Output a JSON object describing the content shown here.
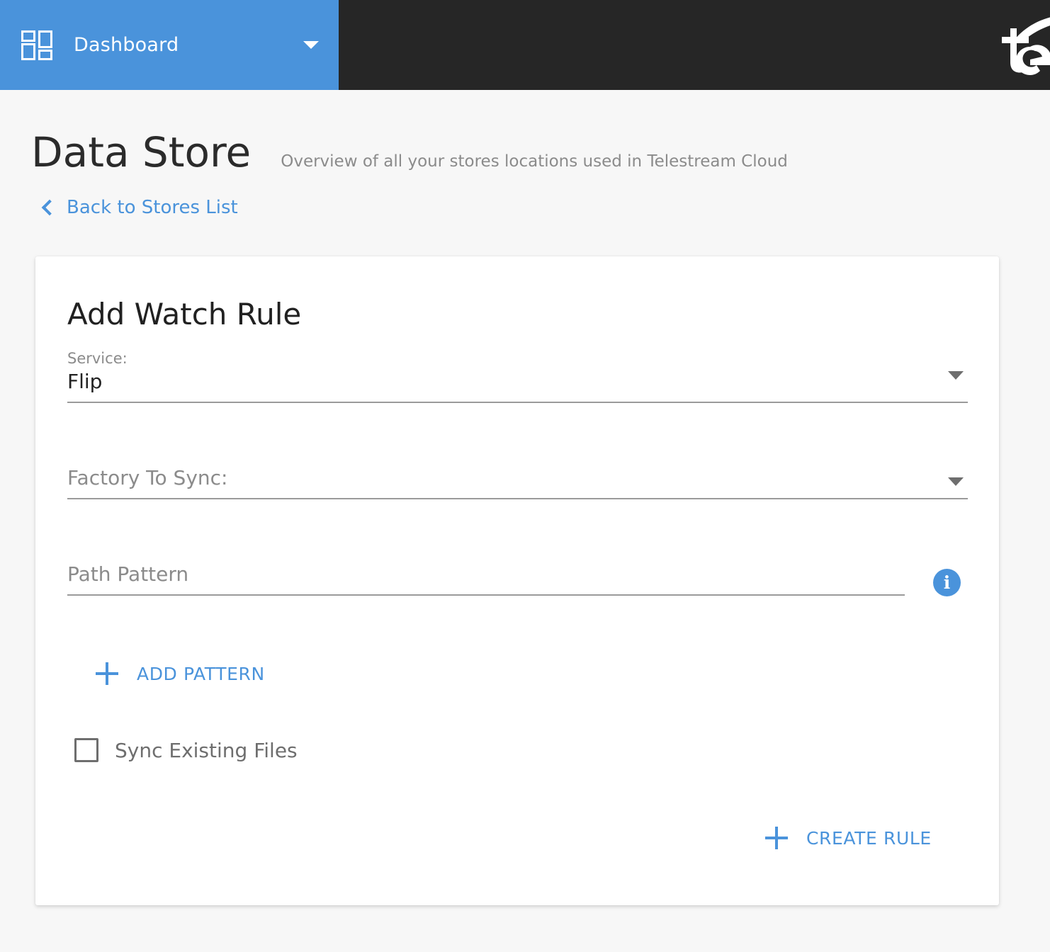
{
  "topbar": {
    "nav_label": "Dashboard",
    "nav_icon": "dashboard-grid-icon",
    "caret_icon": "caret-down-icon",
    "brand_logo_text": "te",
    "blue": "#4a93db",
    "dark": "#262626"
  },
  "page": {
    "title": "Data Store",
    "subtitle": "Overview of all your stores locations used in Telestream Cloud",
    "back_link": "Back to Stores List",
    "back_icon": "chevron-left-icon"
  },
  "card": {
    "title": "Add Watch Rule",
    "service": {
      "label": "Service:",
      "value": "Flip",
      "caret_icon": "caret-down-icon"
    },
    "factory": {
      "placeholder": "Factory To Sync:",
      "value": "",
      "caret_icon": "caret-down-icon"
    },
    "path_pattern": {
      "placeholder": "Path Pattern",
      "value": "",
      "info_icon": "info-icon",
      "info_glyph": "i"
    },
    "add_pattern": {
      "label": "ADD PATTERN",
      "icon": "plus-icon"
    },
    "sync_existing": {
      "label": "Sync Existing Files",
      "checked": false
    },
    "create_rule": {
      "label": "CREATE RULE",
      "icon": "plus-icon"
    }
  },
  "colors": {
    "accent": "#4a93db",
    "page_background": "#f7f7f7",
    "card_background": "#ffffff",
    "muted_text": "#8b8b8b"
  }
}
